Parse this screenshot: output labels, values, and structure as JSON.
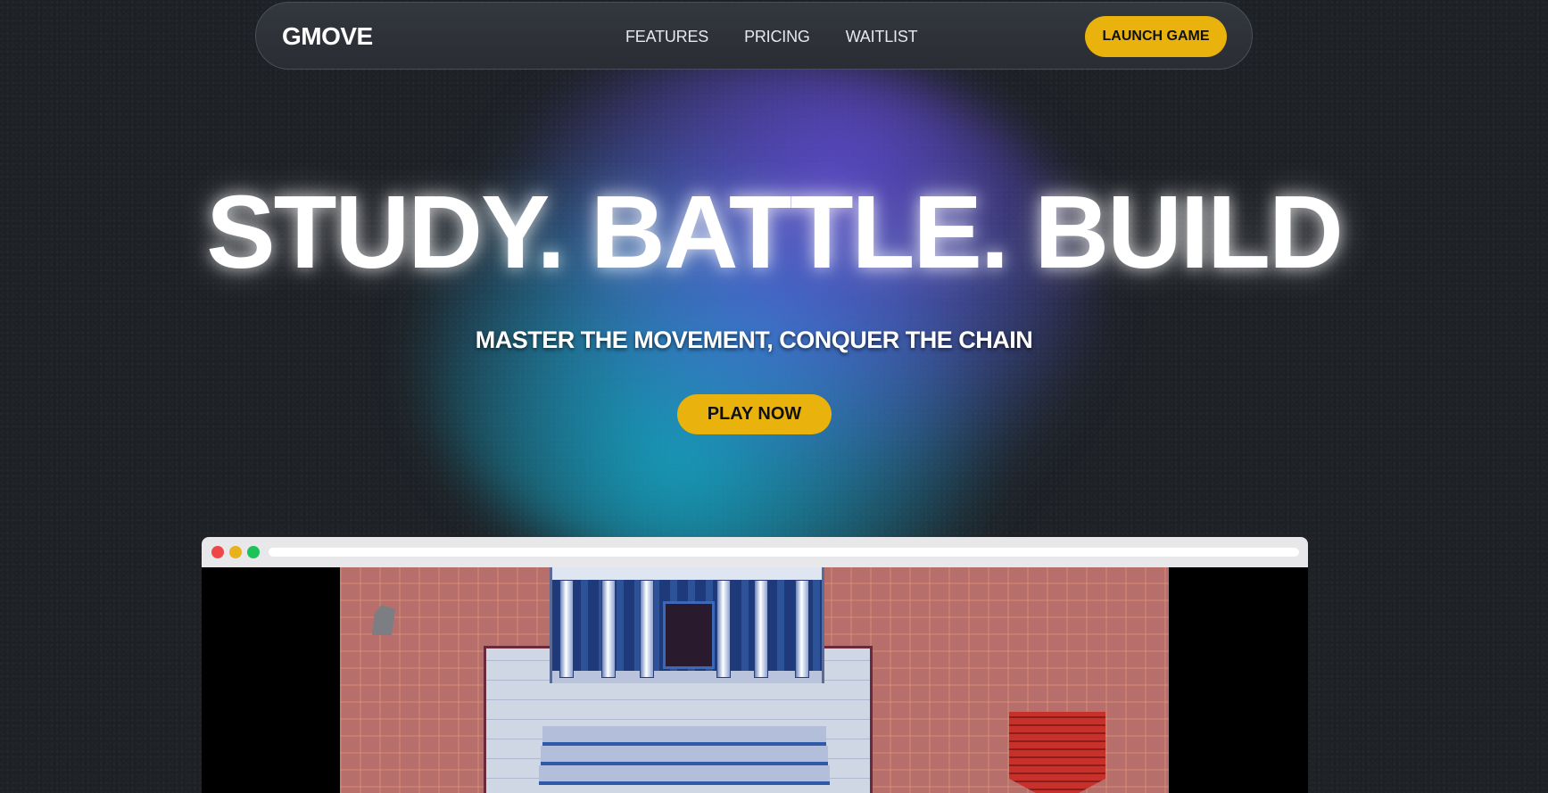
{
  "nav": {
    "logo": "GMOVE",
    "links": [
      {
        "label": "FEATURES"
      },
      {
        "label": "PRICING"
      },
      {
        "label": "WAITLIST"
      }
    ],
    "cta_label": "LAUNCH GAME"
  },
  "hero": {
    "title": "STUDY. BATTLE. BUILD",
    "subtitle": "MASTER THE MOVEMENT, CONQUER THE CHAIN",
    "cta_label": "PLAY NOW"
  },
  "preview": {
    "window_controls": [
      "close",
      "minimize",
      "maximize"
    ],
    "content": "game-screenshot"
  },
  "colors": {
    "accent": "#eab20c",
    "background": "#1d2025",
    "nav_background": "#2f3238",
    "glow_blue": "#3782d2",
    "glow_purple": "#6248d2",
    "glow_cyan": "#14aac8"
  }
}
